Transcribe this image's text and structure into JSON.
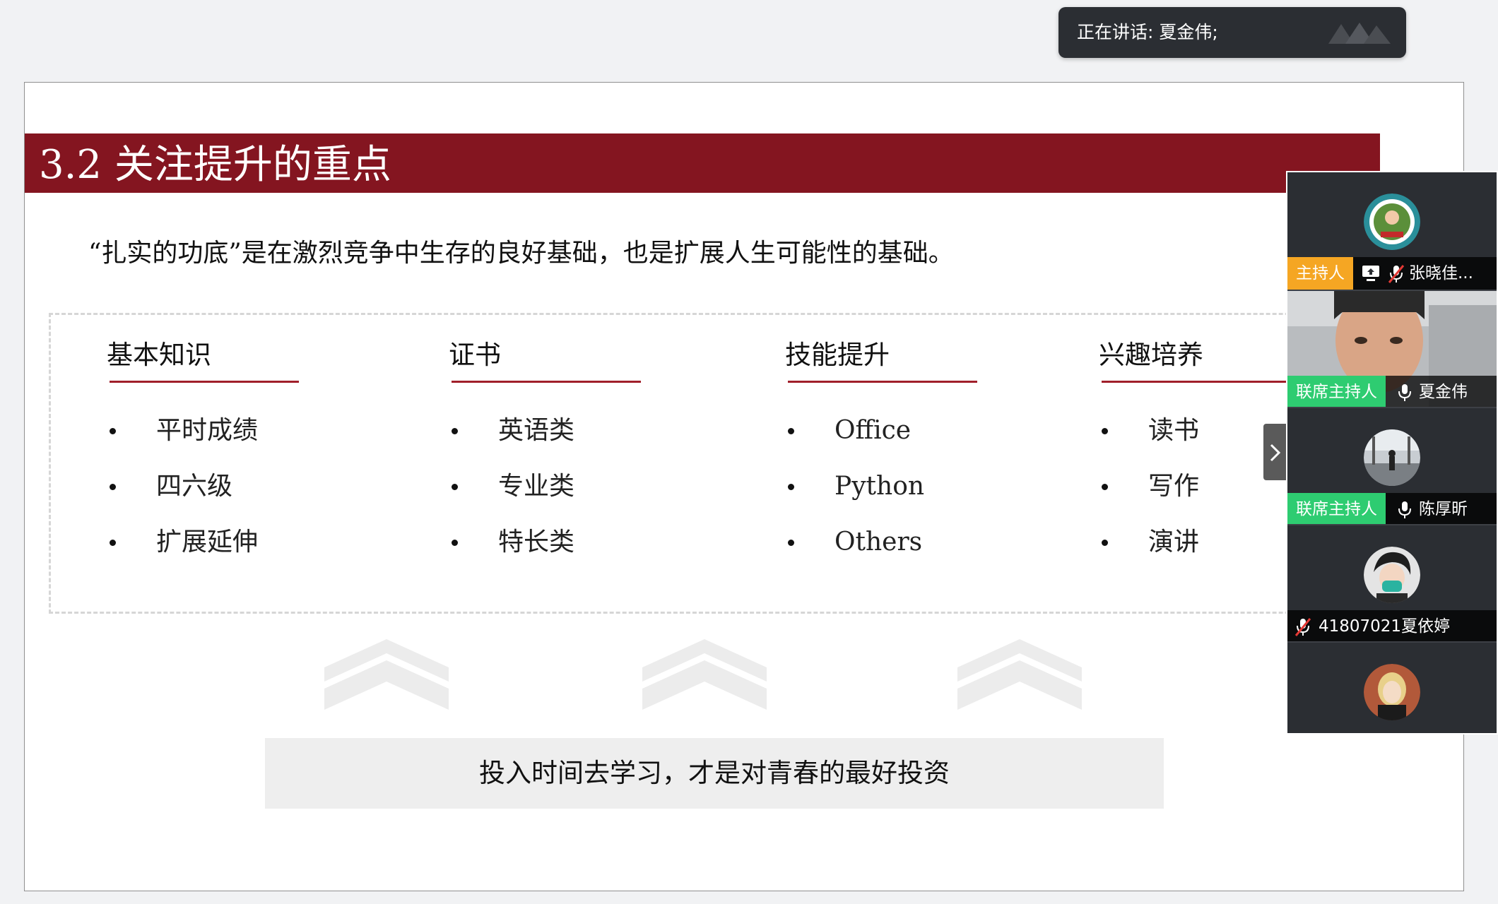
{
  "speaking": {
    "label": "正在讲话: 夏金伟;"
  },
  "slide": {
    "title": "3.2 关注提升的重点",
    "subtitle": "“扎实的功底”是在激烈竞争中生存的良好基础，也是扩展人生可能性的基础。",
    "columns": [
      {
        "header": "基本知识",
        "items": [
          "平时成绩",
          "四六级",
          "扩展延伸"
        ]
      },
      {
        "header": "证书",
        "items": [
          "英语类",
          "专业类",
          "特长类"
        ]
      },
      {
        "header": "技能提升",
        "items": [
          "Office",
          "Python",
          "Others"
        ]
      },
      {
        "header": "兴趣培养",
        "items": [
          "读书",
          "写作",
          "演讲"
        ]
      }
    ],
    "footer": "投入时间去学习，才是对青春的最好投资"
  },
  "participants": [
    {
      "role": "主持人",
      "name": "张晓佳...",
      "role_color": "#f5a623",
      "mic": "muted",
      "sharing": true
    },
    {
      "role": "联席主持人",
      "name": "夏金伟",
      "role_color": "#2ecc71",
      "mic": "on",
      "video": true
    },
    {
      "role": "联席主持人",
      "name": "陈厚昕",
      "role_color": "#2ecc71",
      "mic": "on"
    },
    {
      "role": "",
      "name": "41807021夏依婷",
      "mic": "muted"
    },
    {
      "role": "",
      "name": "",
      "mic": ""
    }
  ],
  "colors": {
    "title_bar": "#841520",
    "accent_line": "#a01f2a",
    "panel": "#2b2e33"
  }
}
